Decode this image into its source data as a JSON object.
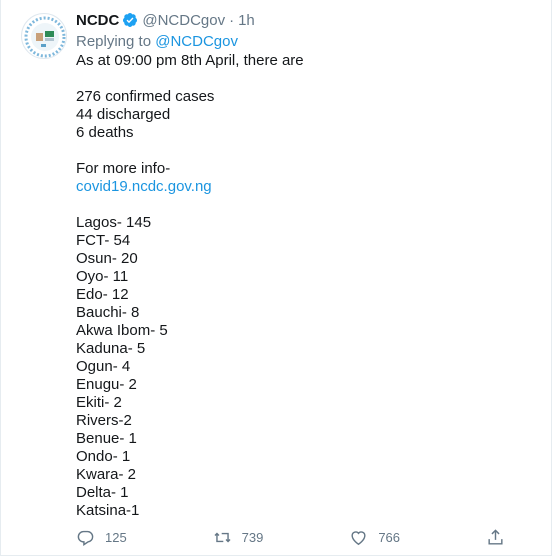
{
  "tweet": {
    "author_name": "NCDC",
    "handle": "@NCDCgov",
    "time": "1h",
    "replying_prefix": "Replying to",
    "replying_to": "@NCDCgov",
    "intro": "As at 09:00 pm 8th April, there are",
    "stats": [
      "276 confirmed cases",
      "44 discharged",
      "6 deaths"
    ],
    "more_info": "For more info-",
    "link": "covid19.ncdc.gov.ng",
    "states": [
      "Lagos- 145",
      "FCT- 54",
      "Osun- 20",
      "Oyo- 11",
      "Edo- 12",
      "Bauchi- 8",
      "Akwa Ibom- 5",
      "Kaduna- 5",
      "Ogun- 4",
      "Enugu- 2",
      "Ekiti- 2",
      "Rivers-2",
      "Benue- 1",
      "Ondo- 1",
      "Kwara- 2",
      "Delta- 1",
      "Katsina-1"
    ]
  },
  "actions": {
    "replies": "125",
    "retweets": "739",
    "likes": "766"
  },
  "colors": {
    "link": "#1b95e0",
    "verified": "#1da1f2",
    "muted": "#657786"
  },
  "icons": [
    "verified-badge-icon",
    "reply-icon",
    "retweet-icon",
    "like-icon",
    "share-icon"
  ]
}
